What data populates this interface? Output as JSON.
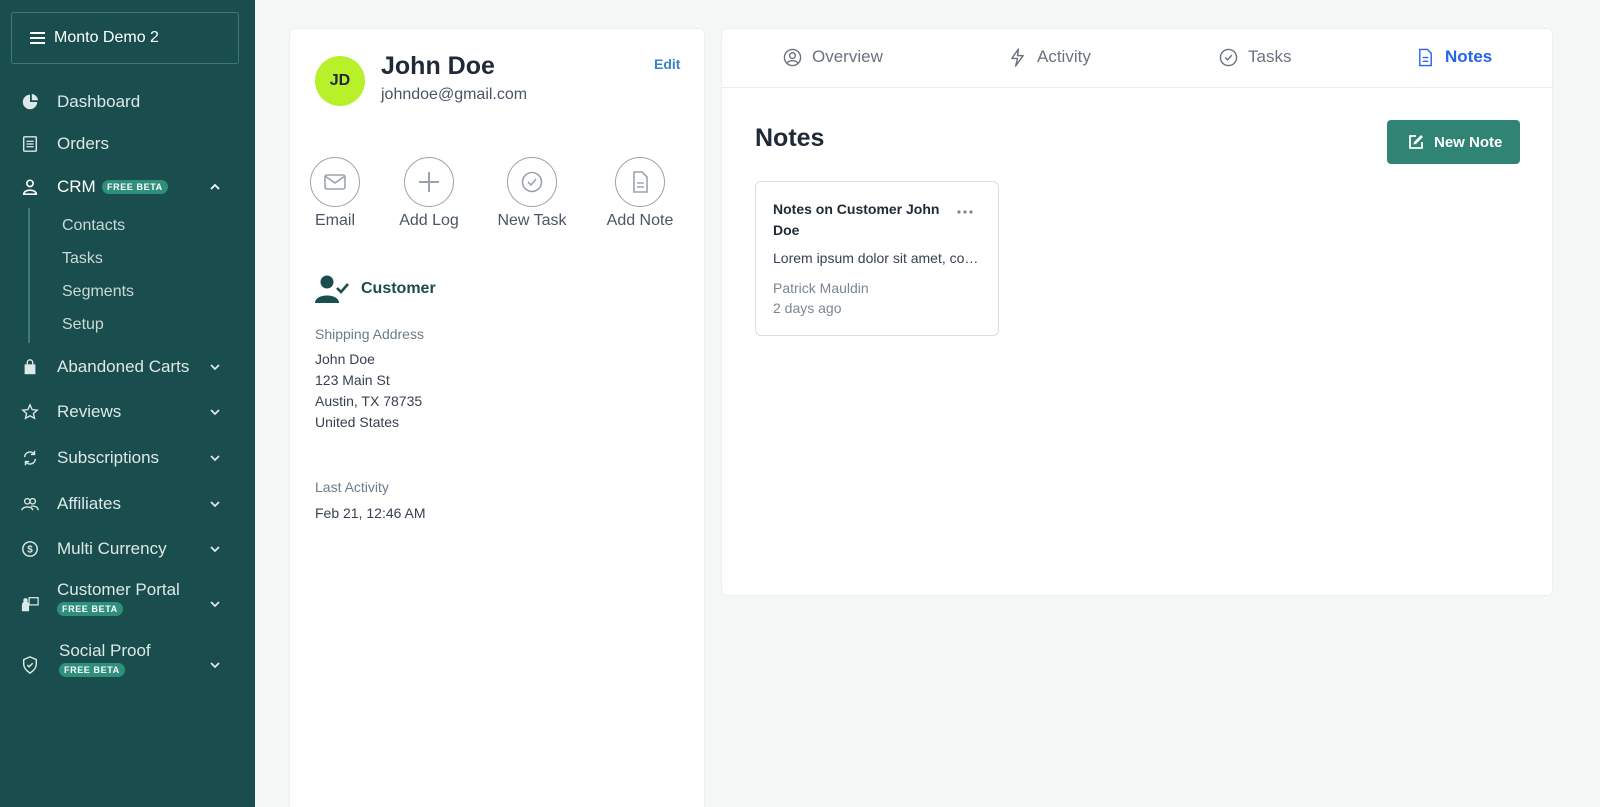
{
  "sidebar": {
    "store_name": "Monto Demo 2",
    "items": [
      {
        "label": "Dashboard",
        "icon": "pie-chart-icon"
      },
      {
        "label": "Orders",
        "icon": "receipt-icon"
      },
      {
        "label": "CRM",
        "icon": "user-icon",
        "badge": "FREE BETA",
        "expanded": true
      },
      {
        "label": "Abandoned Carts",
        "icon": "shopping-bag-icon"
      },
      {
        "label": "Reviews",
        "icon": "star-icon"
      },
      {
        "label": "Subscriptions",
        "icon": "refresh-icon"
      },
      {
        "label": "Affiliates",
        "icon": "users-icon"
      },
      {
        "label": "Multi Currency",
        "icon": "currency-icon"
      },
      {
        "label": "Customer Portal",
        "icon": "portal-icon",
        "badge": "FREE BETA"
      },
      {
        "label": "Social Proof",
        "icon": "shield-check-icon",
        "badge": "FREE BETA"
      }
    ],
    "crm_subitems": [
      "Contacts",
      "Tasks",
      "Segments",
      "Setup"
    ]
  },
  "profile": {
    "initials": "JD",
    "name": "John Doe",
    "email": "johndoe@gmail.com",
    "edit_label": "Edit",
    "actions": [
      "Email",
      "Add Log",
      "New Task",
      "Add Note"
    ],
    "type_label": "Customer",
    "shipping_label": "Shipping Address",
    "shipping_lines": [
      "John Doe",
      "123 Main St",
      "Austin, TX 78735",
      "United States"
    ],
    "last_activity_label": "Last Activity",
    "last_activity_value": "Feb 21, 12:46 AM",
    "avatar_color": "#b8f02a"
  },
  "main": {
    "tabs": [
      {
        "label": "Overview",
        "icon": "user-circle-icon"
      },
      {
        "label": "Activity",
        "icon": "lightning-icon"
      },
      {
        "label": "Tasks",
        "icon": "check-circle-icon"
      },
      {
        "label": "Notes",
        "icon": "document-icon",
        "active": true
      }
    ],
    "heading": "Notes",
    "new_note_label": "New Note",
    "notes": [
      {
        "title": "Notes on Customer John Doe",
        "body": "Lorem ipsum dolor sit amet, consectetur adipiscing elit",
        "author": "Patrick Mauldin",
        "time": "2 days ago"
      }
    ]
  },
  "colors": {
    "sidebar_bg": "#1a4d4d",
    "accent": "#2f8473",
    "active_tab": "#2563eb"
  }
}
